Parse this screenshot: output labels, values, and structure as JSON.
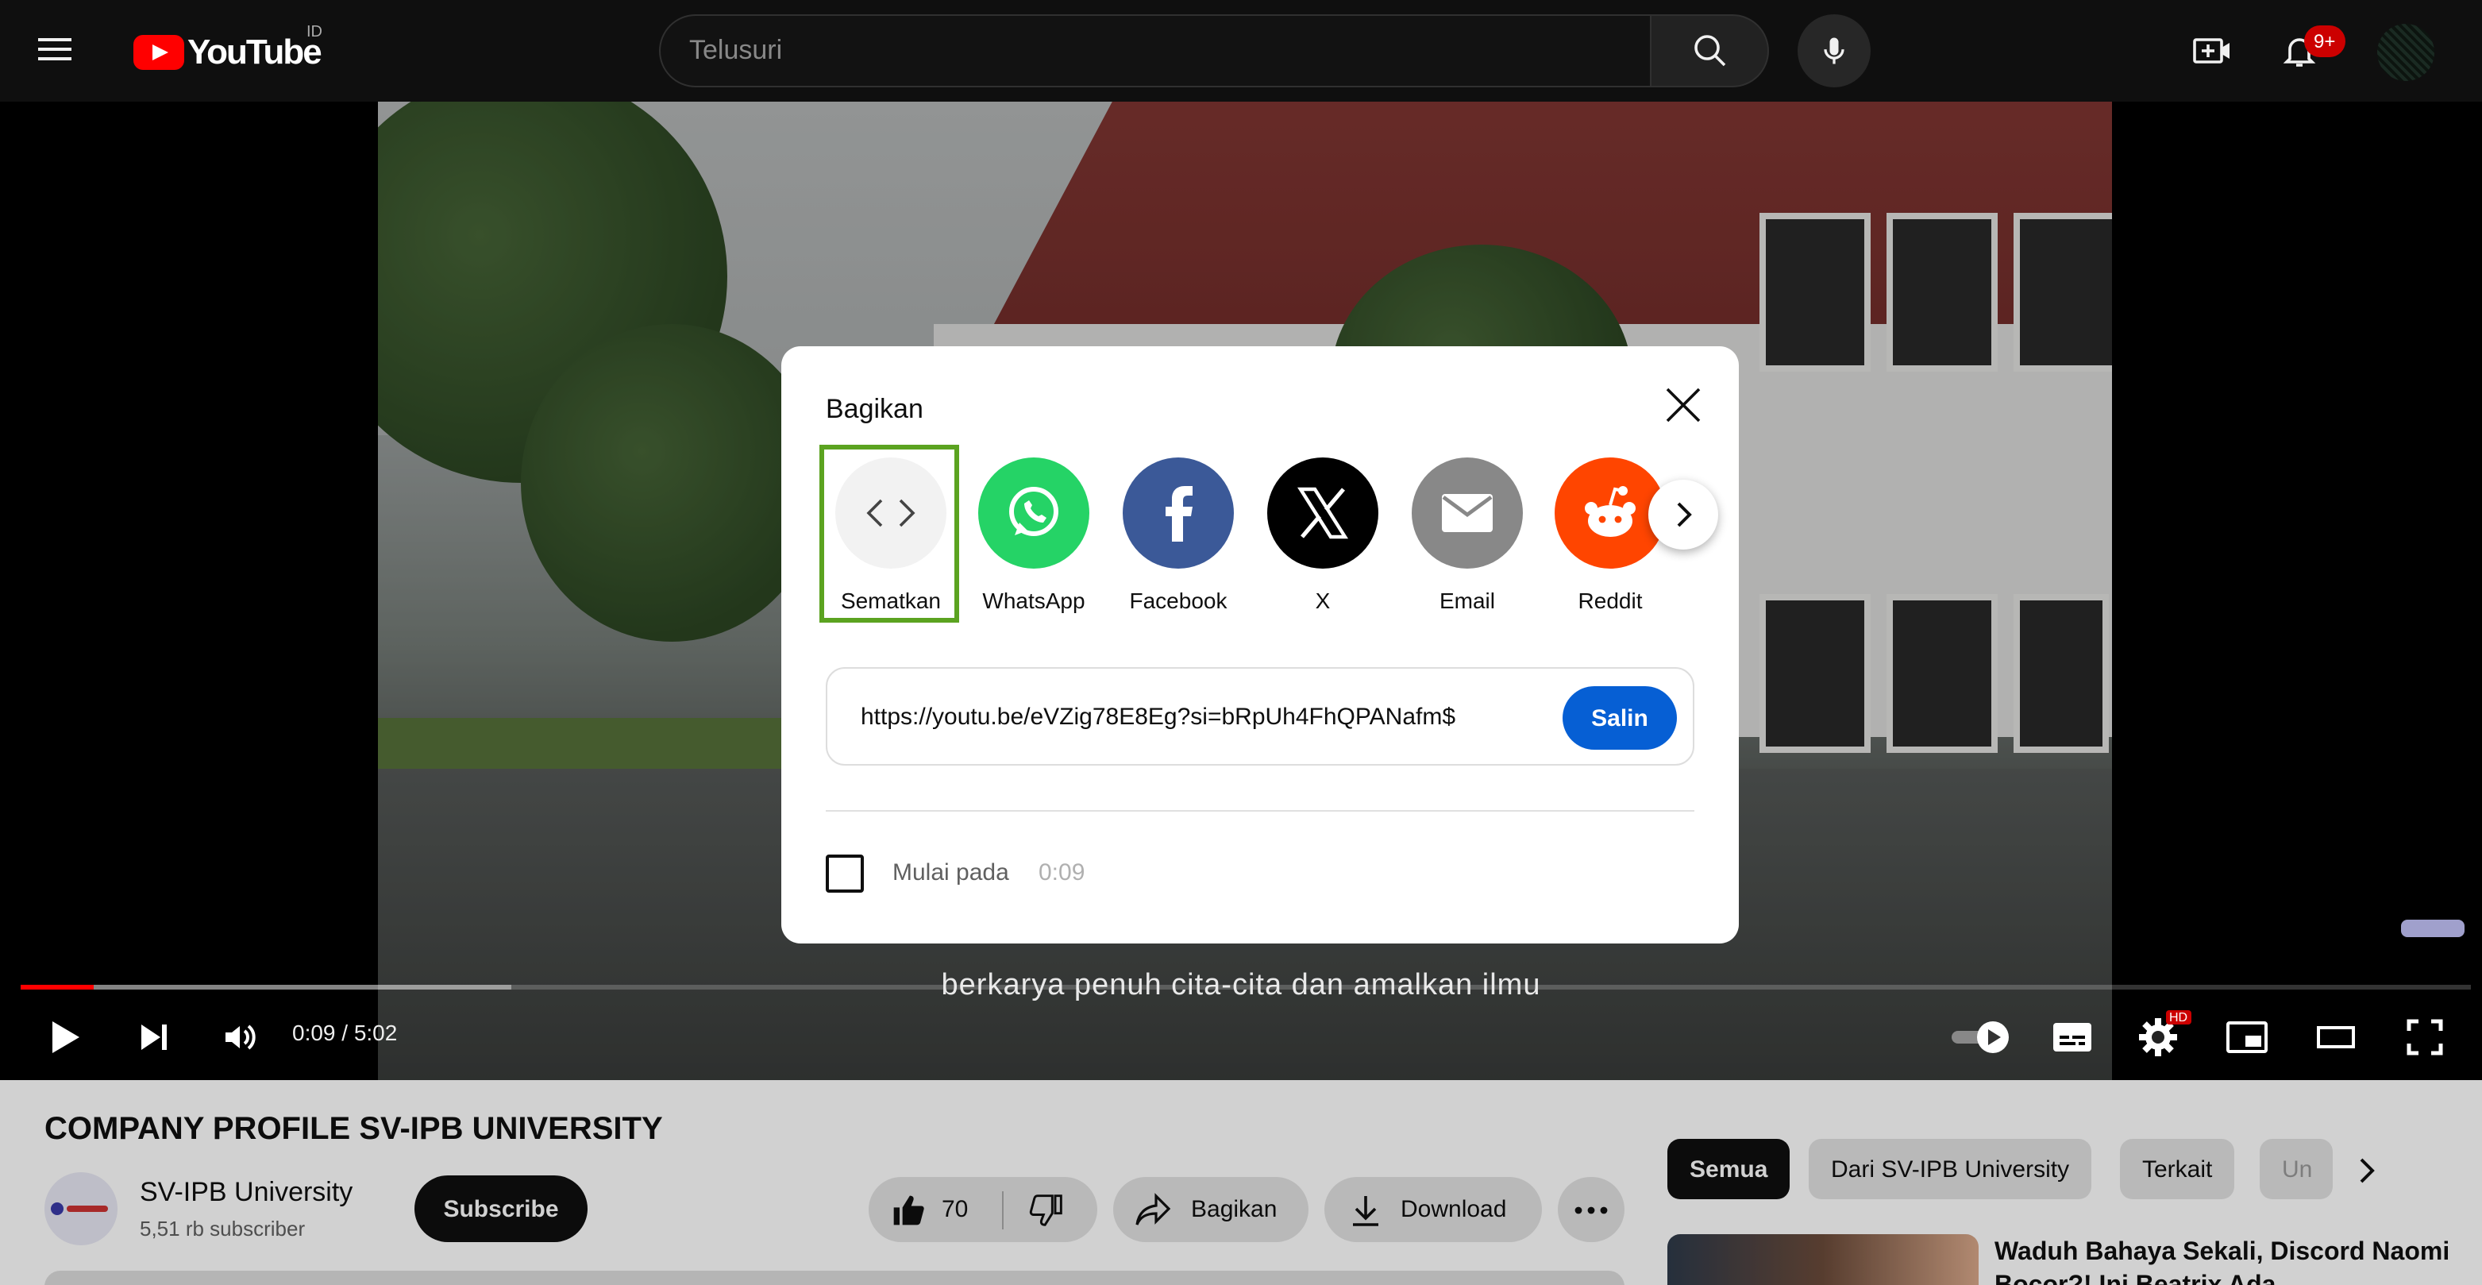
{
  "masthead": {
    "logo_text": "YouTube",
    "country_code": "ID",
    "search_placeholder": "Telusuri",
    "notification_count": "9+"
  },
  "player": {
    "subtitle": "berkarya penuh cita-cita dan amalkan ilmu",
    "time_display": "0:09 / 5:02",
    "progress_played": 0.03,
    "progress_buffered": 0.2,
    "quality_badge": "HD"
  },
  "share_dialog": {
    "title": "Bagikan",
    "targets": [
      {
        "label": "Sematkan",
        "icon": "embed-icon",
        "color": "#f2f2f2"
      },
      {
        "label": "WhatsApp",
        "icon": "whatsapp-icon",
        "color": "#25d366"
      },
      {
        "label": "Facebook",
        "icon": "facebook-icon",
        "color": "#3b5998"
      },
      {
        "label": "X",
        "icon": "x-icon",
        "color": "#000000"
      },
      {
        "label": "Email",
        "icon": "email-icon",
        "color": "#888888"
      },
      {
        "label": "Reddit",
        "icon": "reddit-icon",
        "color": "#ff4500"
      }
    ],
    "url": "https://youtu.be/eVZig78E8Eg?si=bRpUh4FhQPANafm$",
    "copy_label": "Salin",
    "start_at_label": "Mulai pada",
    "start_at_time": "0:09"
  },
  "video": {
    "title": "COMPANY PROFILE SV-IPB UNIVERSITY",
    "channel_name": "SV-IPB University",
    "channel_subs": "5,51 rb subscriber",
    "subscribe_label": "Subscribe",
    "like_count": "70",
    "share_label": "Bagikan",
    "download_label": "Download"
  },
  "chips": [
    "Semua",
    "Dari SV-IPB University",
    "Terkait",
    "Un"
  ],
  "recommendation": {
    "title": "Waduh Bahaya Sekali, Discord Naomi Bocor?! Ini Beatrix Ada"
  },
  "colors": {
    "accent_red": "#ff0000",
    "highlight_green": "#5ba320",
    "copy_blue": "#065fd4"
  }
}
